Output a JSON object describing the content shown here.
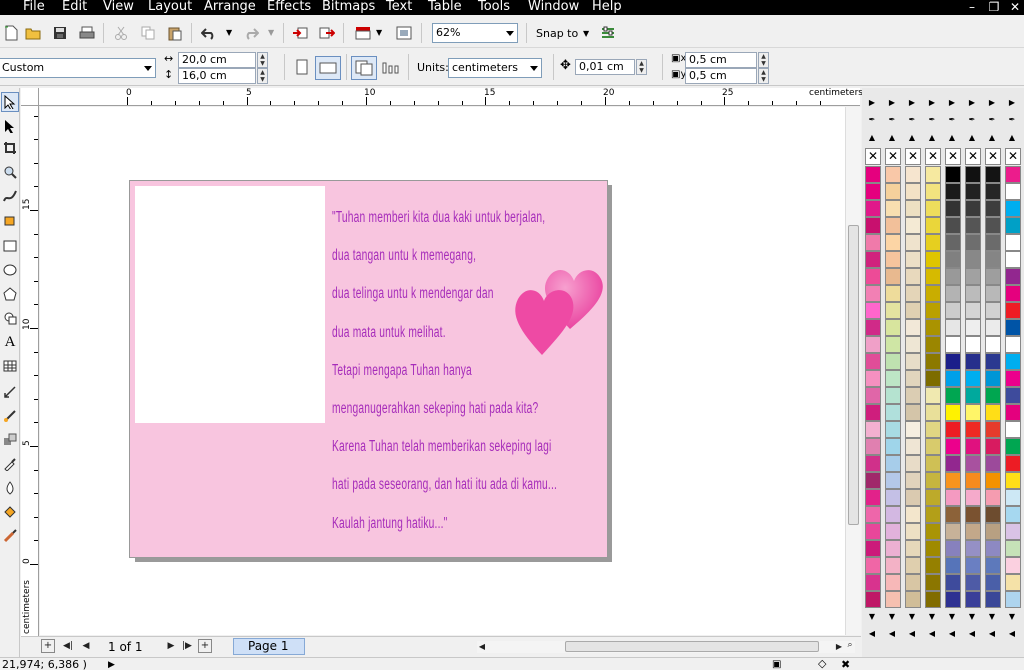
{
  "menu": [
    "File",
    "Edit",
    "View",
    "Layout",
    "Arrange",
    "Effects",
    "Bitmaps",
    "Text",
    "Table",
    "Tools",
    "Window",
    "Help"
  ],
  "toolbar": {
    "zoom": "62%",
    "snap_to": "Snap to"
  },
  "propbar": {
    "page_preset": "Custom",
    "width": "20,0 cm",
    "height": "16,0 cm",
    "units_label": "Units:",
    "units": "centimeters",
    "nudge": "0,01 cm",
    "dup_x": "0,5 cm",
    "dup_y": "0,5 cm"
  },
  "ruler": {
    "units": "centimeters",
    "h_labels": [
      "0",
      "5",
      "10",
      "15",
      "20",
      "25"
    ],
    "v_labels": [
      "15",
      "10",
      "5",
      "0"
    ]
  },
  "document": {
    "quote_lines": [
      "\"Tuhan memberi kita dua kaki untuk berjalan,",
      "dua tangan untu k memegang,",
      "dua telinga untu k mendengar dan",
      "dua mata untuk melihat.",
      "Tetapi mengapa Tuhan hanya",
      "menganugerahkan sekeping hati pada kita?",
      "Karena Tuhan telah memberikan sekeping lagi",
      "hati pada seseorang, dan hati  itu ada di kamu...",
      "Kaulah jantung hatiku...\""
    ],
    "page_bg": "#f8c5df",
    "text_color": "#a62cba",
    "heart_color": "#ee4aa4"
  },
  "pager": {
    "count": "1 of 1",
    "tab": "Page 1"
  },
  "status": {
    "coords": "21,974; 6,386 )"
  },
  "palette_columns": [
    [
      "#e5007e",
      "#e5007e",
      "#e0198a",
      "#c8106e",
      "#f07aaa",
      "#d0237d",
      "#ed4b97",
      "#f280b4",
      "#ff66cc",
      "#d02a88",
      "#f0a0c8",
      "#e04d98",
      "#f590c0",
      "#e066a8",
      "#cf1e7d",
      "#f3b0d0",
      "#e080b0",
      "#d0308a",
      "#a0286a",
      "#e2228a",
      "#ee66aa",
      "#e8469a",
      "#cc1a7a",
      "#f066a6",
      "#d8338e",
      "#bf1766"
    ],
    [
      "#f9c8a8",
      "#f5d19c",
      "#f8dfb0",
      "#f2c09a",
      "#fcd5a5",
      "#f6c49d",
      "#e8b98f",
      "#eedc9b",
      "#e4e3a0",
      "#d8e59e",
      "#cfe6a5",
      "#bfe2b0",
      "#bde6c6",
      "#b5e3d0",
      "#b0e0dc",
      "#a8dbe3",
      "#9fd5ea",
      "#a7cdea",
      "#b4c8e8",
      "#c4c0e6",
      "#d3b8e2",
      "#e2b2dc",
      "#ecb0d2",
      "#f3b2c6",
      "#f7b8b8",
      "#f5c0b0"
    ],
    [
      "#f6e5cf",
      "#f3e2c6",
      "#ede0c2",
      "#f4ead4",
      "#efe3cd",
      "#ecdfc6",
      "#e8d9bd",
      "#e4d5b8",
      "#dfd0b2",
      "#f2e8d8",
      "#eee6d4",
      "#e7ddc8",
      "#e1d5bd",
      "#dbcdb3",
      "#d4c5a9",
      "#f6eee0",
      "#efe5d4",
      "#e8dcc8",
      "#e1d3bc",
      "#dacab0",
      "#f3e6cc",
      "#ede0c4",
      "#e6d8ba",
      "#dfcfae",
      "#d8c6a4",
      "#d0bd98"
    ],
    [
      "#f6e9a0",
      "#f2e37f",
      "#eedd5c",
      "#ead63a",
      "#e6cf1f",
      "#dfc500",
      "#d6ba00",
      "#c9ad00",
      "#baa000",
      "#aa9300",
      "#9b8600",
      "#8c7900",
      "#7d6c00",
      "#f0e9b0",
      "#e9e09a",
      "#e1d683",
      "#d8cb6c",
      "#cfc055",
      "#c6b53f",
      "#bdaa2a",
      "#b39f18",
      "#a99406",
      "#9f8a00",
      "#958000",
      "#8b7600",
      "#816c00"
    ],
    [
      "#000000",
      "#1a1a1a",
      "#333333",
      "#4d4d4d",
      "#666666",
      "#808080",
      "#999999",
      "#b3b3b3",
      "#cccccc",
      "#e6e6e6",
      "#ffffff",
      "#1b1f8a",
      "#00a0e9",
      "#00a651",
      "#fff200",
      "#ed1c24",
      "#ec008c",
      "#92278f",
      "#f7941d",
      "#f49ac1",
      "#8c6239",
      "#c7b299",
      "#8781bd",
      "#5674b9",
      "#3e4b9c",
      "#2e3192"
    ],
    [
      "#111111",
      "#222222",
      "#3a3a3a",
      "#555555",
      "#6e6e6e",
      "#888888",
      "#a1a1a1",
      "#bbbbbb",
      "#d4d4d4",
      "#eeeeee",
      "#ffffff",
      "#262f8c",
      "#00aeef",
      "#00a99d",
      "#fff568",
      "#ee2a24",
      "#e0117f",
      "#a8519f",
      "#f68b1e",
      "#f5aacb",
      "#7a5230",
      "#c3a88a",
      "#9590c5",
      "#6a7fc2",
      "#4e5ba6",
      "#3a3f99"
    ],
    [
      "#141414",
      "#262626",
      "#3d3d3d",
      "#525252",
      "#6b6b6b",
      "#858585",
      "#9e9e9e",
      "#b8b8b8",
      "#d1d1d1",
      "#ebebeb",
      "#ffffff",
      "#2b3990",
      "#0096d6",
      "#00a650",
      "#ffde17",
      "#e53b2c",
      "#d81b60",
      "#9c4a9b",
      "#f39200",
      "#f59cb0",
      "#6d4c2f",
      "#b8a082",
      "#8d89c2",
      "#5d79bb",
      "#4a5fa8",
      "#3a4798"
    ],
    [
      "#ec1c8c",
      "#ffffff",
      "#00aeef",
      "#00a0c6",
      "#ffffff",
      "#ffffff",
      "#92278f",
      "#e5007e",
      "#ee1c24",
      "#0054a6",
      "#ffffff",
      "#00aeef",
      "#ec008c",
      "#3e4b9c",
      "#e4007e",
      "#ffffff",
      "#00a651",
      "#ed1c24",
      "#ffde17",
      "#cde8f5",
      "#a6d8f0",
      "#d9c3e6",
      "#c6e2b8",
      "#fbd0e0",
      "#f5e2a8",
      "#aed4ee"
    ]
  ]
}
